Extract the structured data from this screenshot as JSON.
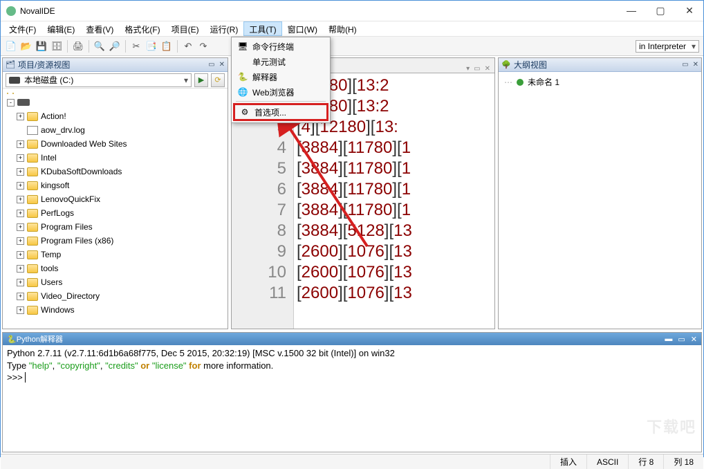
{
  "window": {
    "title": "NovalIDE"
  },
  "menu": {
    "items": [
      "文件(F)",
      "编辑(E)",
      "查看(V)",
      "格式化(F)",
      "项目(E)",
      "运行(R)",
      "工具(T)",
      "窗口(W)",
      "帮助(H)"
    ],
    "active_index": 6
  },
  "toolbar": {
    "interpreter_label": "in Interpreter"
  },
  "dropdown": {
    "items": [
      {
        "icon": "🖥",
        "label": "命令行终端"
      },
      {
        "icon": "",
        "label": "单元测试"
      },
      {
        "icon": "🐍",
        "label": "解释器"
      },
      {
        "icon": "🌐",
        "label": "Web浏览器"
      }
    ],
    "highlighted": {
      "icon": "⚙",
      "label": "首选项..."
    }
  },
  "left": {
    "title": "项目/资源视图",
    "drive": "本地磁盘 (C:)",
    "tree": [
      {
        "exp": "-",
        "type": "drive",
        "label": ""
      },
      {
        "exp": "+",
        "type": "folder",
        "label": "Action!",
        "indent": 1
      },
      {
        "exp": "",
        "type": "file",
        "label": "aow_drv.log",
        "indent": 1
      },
      {
        "exp": "+",
        "type": "folder",
        "label": "Downloaded Web Sites",
        "indent": 1
      },
      {
        "exp": "+",
        "type": "folder",
        "label": "Intel",
        "indent": 1
      },
      {
        "exp": "+",
        "type": "folder",
        "label": "KDubaSoftDownloads",
        "indent": 1
      },
      {
        "exp": "+",
        "type": "folder",
        "label": "kingsoft",
        "indent": 1
      },
      {
        "exp": "+",
        "type": "folder",
        "label": "LenovoQuickFix",
        "indent": 1
      },
      {
        "exp": "+",
        "type": "folder",
        "label": "PerfLogs",
        "indent": 1
      },
      {
        "exp": "+",
        "type": "folder",
        "label": "Program Files",
        "indent": 1
      },
      {
        "exp": "+",
        "type": "folder",
        "label": "Program Files (x86)",
        "indent": 1
      },
      {
        "exp": "+",
        "type": "folder",
        "label": "Temp",
        "indent": 1
      },
      {
        "exp": "+",
        "type": "folder",
        "label": "tools",
        "indent": 1
      },
      {
        "exp": "+",
        "type": "folder",
        "label": "Users",
        "indent": 1
      },
      {
        "exp": "+",
        "type": "folder",
        "label": "Video_Directory",
        "indent": 1
      },
      {
        "exp": "+",
        "type": "folder",
        "label": "Windows",
        "indent": 1
      }
    ]
  },
  "editor": {
    "lines": [
      {
        "n": "",
        "segs": [
          "[",
          "12180",
          "][",
          "13:2"
        ]
      },
      {
        "n": "",
        "segs": [
          "[",
          "12180",
          "][",
          "13:2"
        ]
      },
      {
        "n": "3",
        "segs": [
          "[",
          "4",
          "][",
          "12180",
          "][",
          "13:"
        ]
      },
      {
        "n": "4",
        "segs": [
          "[",
          "3884",
          "][",
          "11780",
          "][",
          "1"
        ]
      },
      {
        "n": "5",
        "segs": [
          "[",
          "3884",
          "][",
          "11780",
          "][",
          "1"
        ]
      },
      {
        "n": "6",
        "segs": [
          "[",
          "3884",
          "][",
          "11780",
          "][",
          "1"
        ]
      },
      {
        "n": "7",
        "segs": [
          "[",
          "3884",
          "][",
          "11780",
          "][",
          "1"
        ]
      },
      {
        "n": "8",
        "segs": [
          "[",
          "3884",
          "][",
          "5128",
          "][",
          "13"
        ]
      },
      {
        "n": "9",
        "segs": [
          "[",
          "2600",
          "][",
          "1076",
          "][",
          "13"
        ]
      },
      {
        "n": "10",
        "segs": [
          "[",
          "2600",
          "][",
          "1076",
          "][",
          "13"
        ]
      },
      {
        "n": "11",
        "segs": [
          "[",
          "2600",
          "][",
          "1076",
          "][",
          "13"
        ]
      }
    ]
  },
  "right": {
    "title": "大纲视图",
    "item": "未命名 1"
  },
  "console": {
    "title": "Python解释器",
    "line1_a": "Python 2.7.11 (v2.7.11:6d1b6a68f775, Dec  5 2015, 20:32:19) [MSC v.1500 32 bit (Intel)] on win32",
    "line2_a": "Type ",
    "line2_s1": "\"help\"",
    "line2_b": ", ",
    "line2_s2": "\"copyright\"",
    "line2_c": ", ",
    "line2_s3": "\"credits\"",
    "line2_d": " ",
    "line2_k1": "or",
    "line2_e": " ",
    "line2_s4": "\"license\"",
    "line2_f": " ",
    "line2_k2": "for",
    "line2_g": " more information.",
    "prompt": ">>> "
  },
  "status": {
    "insert": "插入",
    "encoding": "ASCII",
    "row": "行 8",
    "col": "列 18"
  },
  "watermark": "下载吧"
}
